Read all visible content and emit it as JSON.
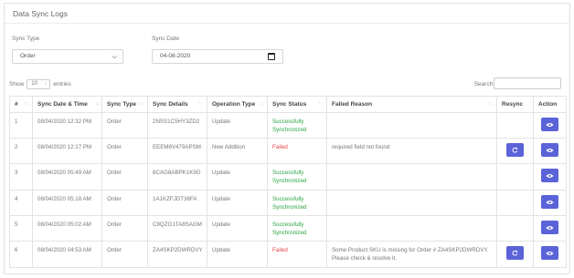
{
  "page_title": "Data Sync Logs",
  "filters": {
    "sync_type_label": "Sync Type",
    "sync_type_value": "Order",
    "sync_date_label": "Sync Date",
    "sync_date_value": "04-08-2020"
  },
  "table_controls": {
    "show_label": "Show",
    "entries_value": "10",
    "entries_label": "entries",
    "search_label": "Search:"
  },
  "columns": [
    "#",
    "Sync Date & Time",
    "Sync Type",
    "Sync Details",
    "Operation Type",
    "Sync Status",
    "Failed Reason",
    "Resync",
    "Action"
  ],
  "rows": [
    {
      "num": "1",
      "datetime": "08/04/2020 12:32 PM",
      "type": "Order",
      "details": "2NSS1C5HY3ZD2",
      "operation": "Update",
      "status": "Successfully Synchronized",
      "status_kind": "ok",
      "reason": "",
      "resync": false
    },
    {
      "num": "2",
      "datetime": "08/04/2020 12:17 PM",
      "type": "Order",
      "details": "EEEM8V479APSM",
      "operation": "New Addition",
      "status": "Failed",
      "status_kind": "fail",
      "reason": "required field not found",
      "resync": true
    },
    {
      "num": "3",
      "datetime": "08/04/2020 05:49 AM",
      "type": "Order",
      "details": "8CAG8ABPK1K9G",
      "operation": "Update",
      "status": "Successfully Synchronized",
      "status_kind": "ok",
      "reason": "",
      "resync": false
    },
    {
      "num": "4",
      "datetime": "08/04/2020 05:18 AM",
      "type": "Order",
      "details": "1A1KZFJDT36FA",
      "operation": "Update",
      "status": "Successfully Synchronized",
      "status_kind": "ok",
      "reason": "",
      "resync": false
    },
    {
      "num": "5",
      "datetime": "08/04/2020 05:02 AM",
      "type": "Order",
      "details": "C8QZG1TA8SAGM",
      "operation": "Update",
      "status": "Successfully Synchronized",
      "status_kind": "ok",
      "reason": "",
      "resync": false
    },
    {
      "num": "6",
      "datetime": "08/04/2020 04:53 AM",
      "type": "Order",
      "details": "ZA4SKP2DWRDVY",
      "operation": "Update",
      "status": "Failed",
      "status_kind": "fail",
      "reason": "Some Product SKU is missing for Order # ZA4SKP2DWRDVY. Please check & resolve it.",
      "resync": true
    }
  ],
  "colors": {
    "accent": "#5a63d8",
    "success": "#2aa542",
    "failed": "#e64545"
  },
  "icons": {
    "resync": "refresh-icon",
    "action": "eye-icon",
    "sync_date": "calendar-icon",
    "sync_type": "chevron-down-icon"
  }
}
